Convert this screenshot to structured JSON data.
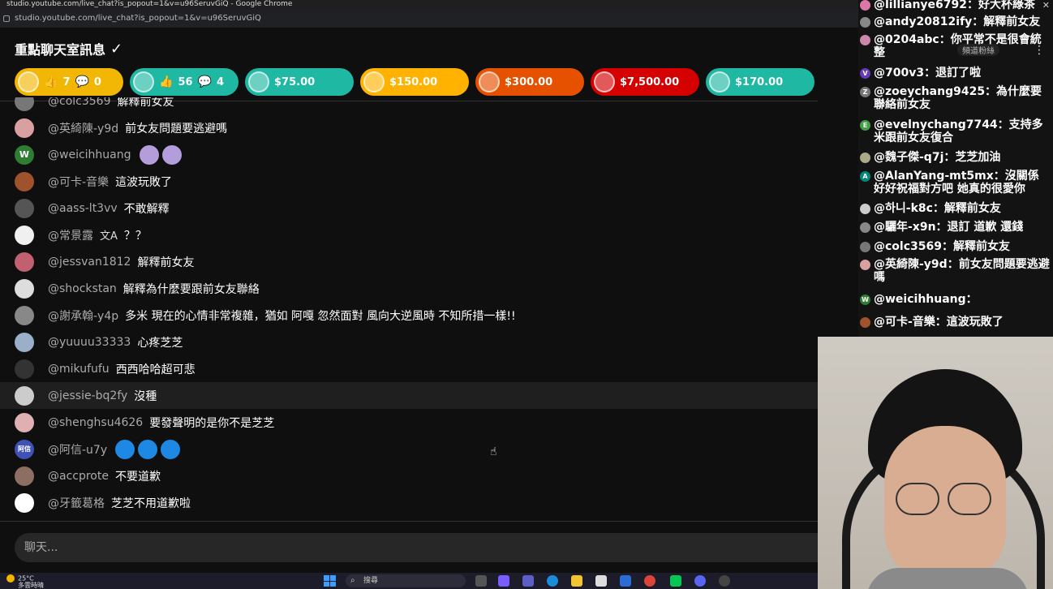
{
  "window": {
    "title": "studio.youtube.com/live_chat?is_popout=1&v=u96SeruvGiQ - Google Chrome",
    "url": "studio.youtube.com/live_chat?is_popout=1&v=u96SeruvGiQ"
  },
  "chat": {
    "header": "重點聊天室訊息",
    "input_placeholder": "聊天..."
  },
  "ticker": [
    {
      "label": "7",
      "secondary": "0",
      "color": "#f2b705",
      "type": "likes"
    },
    {
      "label": "56",
      "secondary": "4",
      "color": "#1eb8a3",
      "type": "likes"
    },
    {
      "label": "$75.00",
      "color": "#1eb8a3"
    },
    {
      "label": "$150.00",
      "color": "#ffb300"
    },
    {
      "label": "$300.00",
      "color": "#e65100"
    },
    {
      "label": "$7,500.00",
      "color": "#d50000"
    },
    {
      "label": "$170.00",
      "color": "#1eb8a3"
    },
    {
      "label": "",
      "color": "#1eb8a3"
    }
  ],
  "messages": [
    {
      "author": "@colc3569",
      "text": "解釋前女友",
      "avatar_color": "#777"
    },
    {
      "author": "@英綺陳-y9d",
      "text": "前女友問題要逃避嗎",
      "avatar_color": "#d9a0a0"
    },
    {
      "author": "@weicihhuang",
      "text": "",
      "avatar_letter": "W",
      "avatar_color": "#2e7d32",
      "emoji_count": 2,
      "emoji_color": "#b39ddb"
    },
    {
      "author": "@可卡-音樂",
      "text": "這波玩敗了",
      "avatar_color": "#a0522d"
    },
    {
      "author": "@aass-lt3vv",
      "text": "不敢解釋",
      "avatar_color": "#555"
    },
    {
      "author": "@常景露",
      "text": "？？",
      "avatar_color": "#f0f0f0",
      "translated": true
    },
    {
      "author": "@jessvan1812",
      "text": "解釋前女友",
      "avatar_color": "#c06070"
    },
    {
      "author": "@shockstan",
      "text": "解釋為什麼要跟前女友聯絡",
      "avatar_color": "#ddd"
    },
    {
      "author": "@謝承翰-y4p",
      "text": "多米 現在的心情非常複雜，猶如 阿嘎 忽然面對 風向大逆風時 不知所措一樣!!",
      "avatar_color": "#888"
    },
    {
      "author": "@yuuuu33333",
      "text": "心疼芝芝",
      "avatar_color": "#9bb0c8"
    },
    {
      "author": "@mikufufu",
      "text": "西西哈哈超可悲",
      "avatar_color": "#333"
    },
    {
      "author": "@jessie-bq2fy",
      "text": "沒種",
      "avatar_color": "#ccc",
      "highlighted": true
    },
    {
      "author": "@shenghsu4626",
      "text": "要發聲明的是你不是芝芝",
      "avatar_color": "#e0b0b0"
    },
    {
      "author": "@阿信-u7y",
      "text": "",
      "avatar_letter": "阿信",
      "avatar_color": "#3f51b5",
      "emoji_count": 3,
      "emoji_color": "#1e88e5"
    },
    {
      "author": "@accprote",
      "text": "不要道歉",
      "avatar_color": "#8d6e63"
    },
    {
      "author": "@牙籤葛格",
      "text": "芝芝不用道歉啦",
      "avatar_color": "#fff"
    }
  ],
  "overlay": {
    "tag": "頻道粉絲",
    "lines": [
      {
        "text": "@lillianye6792：好大杯綠茶",
        "color": "#d7a"
      },
      {
        "text": "@andy20812ify：解釋前女友",
        "color": "#888"
      },
      {
        "text": "@0204abc：你平常不是很會統整",
        "color": "#c8a"
      },
      {
        "text": "@700v3：退訂了啦",
        "color": "#673ab7",
        "letter": "V"
      },
      {
        "text": "@zoeychang9425：為什麼要聯絡前女友",
        "color": "#777",
        "letter": "Z"
      },
      {
        "text": "@evelnychang7744：支持多米跟前女友復合",
        "color": "#43a047",
        "letter": "E"
      },
      {
        "text": "@魏子傑-q7j：芝芝加油",
        "color": "#aa8"
      },
      {
        "text": "@AlanYang-mt5mx：沒關係 好好祝福對方吧 她真的很愛你",
        "color": "#00897b",
        "letter": "A"
      },
      {
        "text": "@하니-k8c：解釋前女友",
        "color": "#ccc"
      },
      {
        "text": "@驪年-x9n：退訂 道歉 還錢",
        "color": "#888"
      },
      {
        "text": "@colc3569：解釋前女友",
        "color": "#777"
      },
      {
        "text": "@英綺陳-y9d：前女友問題要逃避嗎",
        "color": "#d9a0a0"
      },
      {
        "text": "@weicihhuang：",
        "color": "#2e7d32",
        "letter": "W"
      },
      {
        "text": "@可卡-音樂：這波玩敗了",
        "color": "#a0522d"
      }
    ]
  },
  "taskbar": {
    "temp": "25°C",
    "weather": "多雲時晴",
    "search": "搜尋"
  }
}
